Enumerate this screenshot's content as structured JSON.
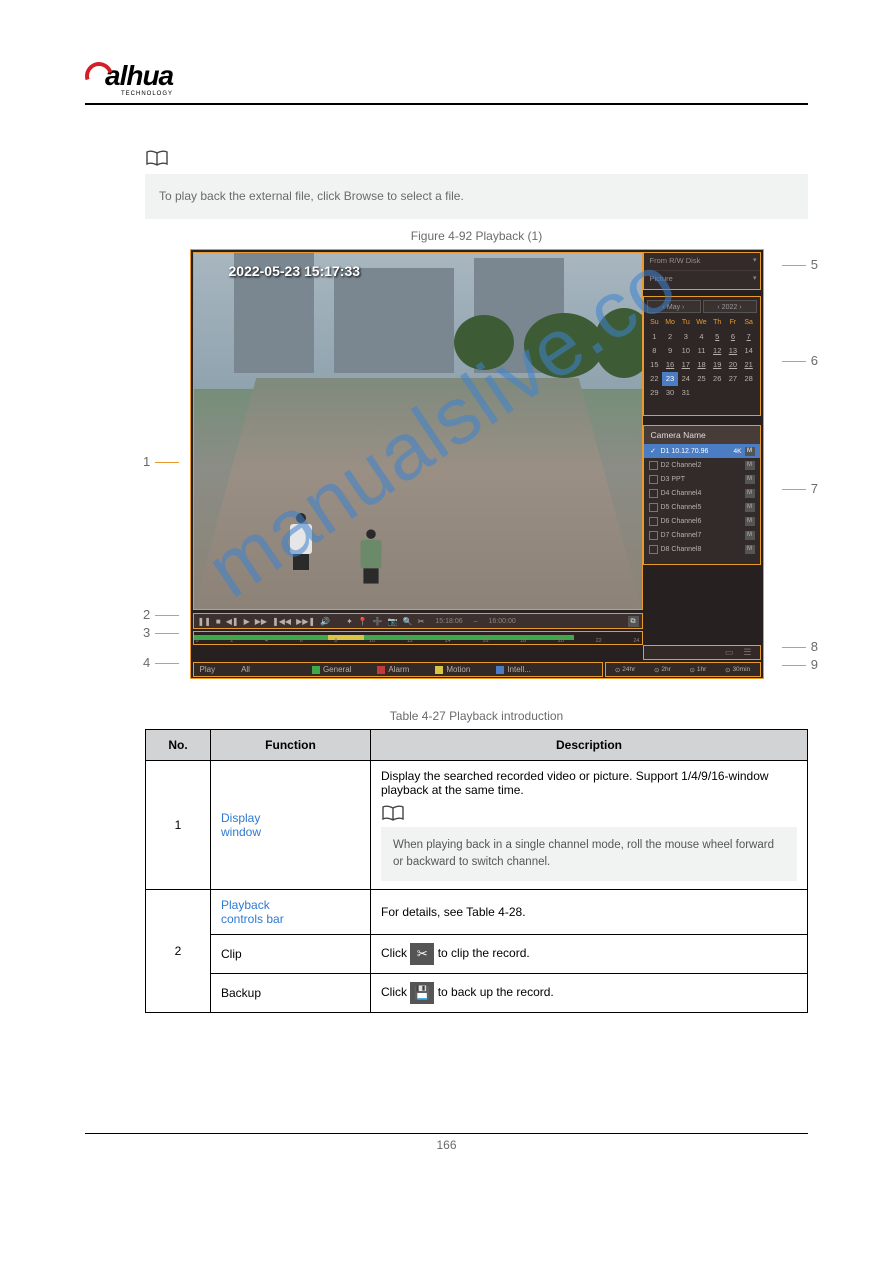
{
  "logo": {
    "brand": "alhua",
    "sub": "TECHNOLOGY"
  },
  "note1": "To play back the external file, click Browse to select a file.",
  "figure_caption": "Figure 4-92 Playback (1)",
  "callouts": {
    "c1": "1",
    "c2": "2",
    "c3": "3",
    "c4": "4",
    "c5": "5",
    "c6": "6",
    "c7": "7",
    "c8": "8",
    "c9": "9"
  },
  "video": {
    "timestamp": "2022-05-23 15:17:33"
  },
  "panel_top": {
    "row1": "From R/W Disk",
    "row2": "Picture"
  },
  "calendar": {
    "month": "May",
    "year": "2022",
    "dow": [
      "Su",
      "Mo",
      "Tu",
      "We",
      "Th",
      "Fr",
      "Sa"
    ],
    "days": [
      "1",
      "2",
      "3",
      "4",
      "5",
      "6",
      "7",
      "8",
      "9",
      "10",
      "11",
      "12",
      "13",
      "14",
      "15",
      "16",
      "17",
      "18",
      "19",
      "20",
      "21",
      "22",
      "23",
      "24",
      "25",
      "26",
      "27",
      "28",
      "29",
      "30",
      "31",
      "",
      "",
      "",
      ""
    ],
    "selected": "23",
    "dotted": [
      "5",
      "6",
      "7",
      "12",
      "13",
      "16",
      "17",
      "18",
      "19",
      "20",
      "21"
    ]
  },
  "camlist": {
    "header": "Camera Name",
    "rows": [
      {
        "name": "D1 10.12.70.96",
        "extra": "4K",
        "sel": true
      },
      {
        "name": "D2 Channel2",
        "extra": "",
        "sel": false
      },
      {
        "name": "D3 PPT",
        "extra": "",
        "sel": false
      },
      {
        "name": "D4 Channel4",
        "extra": "",
        "sel": false
      },
      {
        "name": "D5 Channel5",
        "extra": "",
        "sel": false
      },
      {
        "name": "D6 Channel6",
        "extra": "",
        "sel": false
      },
      {
        "name": "D7 Channel7",
        "extra": "",
        "sel": false
      },
      {
        "name": "D8 Channel8",
        "extra": "",
        "sel": false
      }
    ],
    "m": "M"
  },
  "toolbar": {
    "time1": "15:18:06",
    "time2": "16:00:00",
    "q": "⧉"
  },
  "bottombar": {
    "play": "Play",
    "all": "All",
    "general": "General",
    "alarm": "Alarm",
    "motion": "Motion",
    "intel": "Intell..."
  },
  "zoom": {
    "z24": "24hr",
    "z2": "2hr",
    "z1": "1hr",
    "z30": "30min"
  },
  "table_caption": "Table 4-27 Playback introduction",
  "table": {
    "h_no": "No.",
    "h_func": "Function",
    "h_desc": "Description",
    "r1_no": "1",
    "r1_func": "Display\nwindow",
    "r1_desc": "Display the searched recorded video or picture. Support 1/4/9/16-window playback at the same time.",
    "r1_note": "When playing back in a single channel mode, roll the mouse wheel forward or backward to switch channel.",
    "r2_no": "2",
    "r2a_func": "Playback\ncontrols bar",
    "r2a_desc": "For details, see Table 4-28.",
    "r2b_func": "Clip",
    "r2b_desc_pre": "Click ",
    "r2b_desc_post": " to clip the record.",
    "r2c_func": "Backup",
    "r2c_desc_pre": "Click ",
    "r2c_desc_post": " to back up the record."
  },
  "footer_page": "166"
}
